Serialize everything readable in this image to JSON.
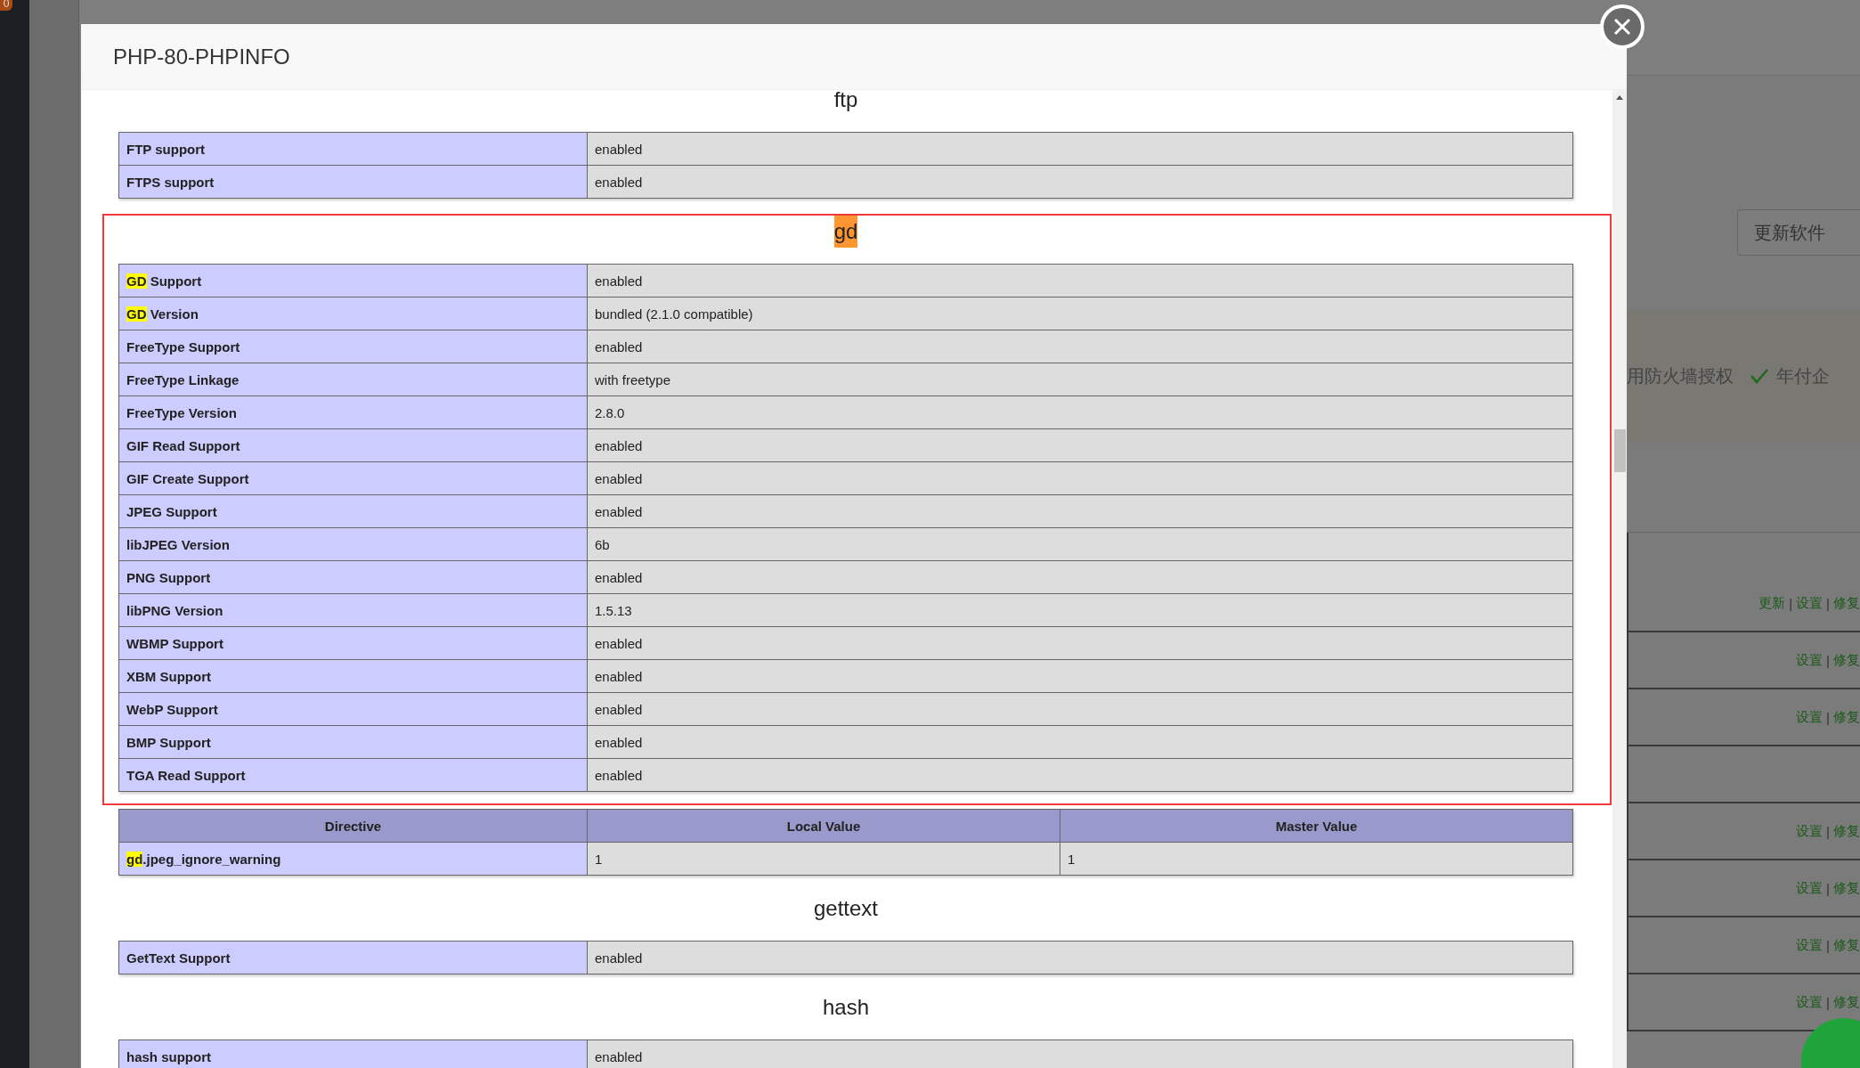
{
  "background": {
    "badge": "0",
    "update_button": "更新软件",
    "band_items": [
      {
        "text": "用防火墙授权",
        "checked": false
      },
      {
        "text": "年付企",
        "checked": true
      }
    ],
    "table_rows": [
      [
        {
          "kind": "link",
          "text": "更新"
        },
        {
          "kind": "separator",
          "text": "|"
        },
        {
          "kind": "link",
          "text": "设置"
        },
        {
          "kind": "separator",
          "text": "|"
        },
        {
          "kind": "link",
          "text": "修复"
        }
      ],
      [
        {
          "kind": "link",
          "text": "设置"
        },
        {
          "kind": "separator",
          "text": "|"
        },
        {
          "kind": "link",
          "text": "修复"
        }
      ],
      [
        {
          "kind": "link",
          "text": "设置"
        },
        {
          "kind": "separator",
          "text": "|"
        },
        {
          "kind": "link",
          "text": "修复"
        }
      ],
      [],
      [
        {
          "kind": "link",
          "text": "设置"
        },
        {
          "kind": "separator",
          "text": "|"
        },
        {
          "kind": "link",
          "text": "修复"
        }
      ],
      [
        {
          "kind": "link",
          "text": "设置"
        },
        {
          "kind": "separator",
          "text": "|"
        },
        {
          "kind": "link",
          "text": "修复"
        }
      ],
      [
        {
          "kind": "link",
          "text": "设置"
        },
        {
          "kind": "separator",
          "text": "|"
        },
        {
          "kind": "link",
          "text": "修复"
        }
      ],
      [
        {
          "kind": "link",
          "text": "设置"
        },
        {
          "kind": "separator",
          "text": "|"
        },
        {
          "kind": "link",
          "text": "修复"
        }
      ]
    ]
  },
  "dialog": {
    "title": "PHP-80-PHPINFO",
    "sections": [
      {
        "title": "ftp",
        "highlighted": false,
        "annotated": false,
        "rows": [
          {
            "name": "FTP support",
            "value": "enabled"
          },
          {
            "name": "FTPS support",
            "value": "enabled"
          }
        ]
      },
      {
        "title": "gd",
        "highlighted": true,
        "annotated": true,
        "rows": [
          {
            "match": "GD",
            "name": " Support",
            "value": "enabled"
          },
          {
            "match": "GD",
            "name": " Version",
            "value": "bundled (2.1.0 compatible)"
          },
          {
            "name": "FreeType Support",
            "value": "enabled"
          },
          {
            "name": "FreeType Linkage",
            "value": "with freetype"
          },
          {
            "name": "FreeType Version",
            "value": "2.8.0"
          },
          {
            "name": "GIF Read Support",
            "value": "enabled"
          },
          {
            "name": "GIF Create Support",
            "value": "enabled"
          },
          {
            "name": "JPEG Support",
            "value": "enabled"
          },
          {
            "name": "libJPEG Version",
            "value": "6b"
          },
          {
            "name": "PNG Support",
            "value": "enabled"
          },
          {
            "name": "libPNG Version",
            "value": "1.5.13"
          },
          {
            "name": "WBMP Support",
            "value": "enabled"
          },
          {
            "name": "XBM Support",
            "value": "enabled"
          },
          {
            "name": "WebP Support",
            "value": "enabled"
          },
          {
            "name": "BMP Support",
            "value": "enabled"
          },
          {
            "name": "TGA Read Support",
            "value": "enabled"
          }
        ],
        "directives": {
          "columns": [
            "Directive",
            "Local Value",
            "Master Value"
          ],
          "rows": [
            {
              "match": "gd",
              "name": ".jpeg_ignore_warning",
              "local": "1",
              "master": "1"
            }
          ]
        }
      },
      {
        "title": "gettext",
        "highlighted": false,
        "annotated": false,
        "rows": [
          {
            "name": "GetText Support",
            "value": "enabled"
          }
        ]
      },
      {
        "title": "hash",
        "highlighted": false,
        "annotated": false,
        "rows": [
          {
            "name": "hash support",
            "value": "enabled"
          }
        ]
      }
    ]
  }
}
